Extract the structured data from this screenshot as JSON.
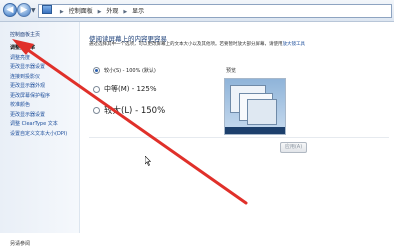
{
  "address_bar": {
    "icon": "control-panel-icon",
    "crumbs": [
      "控制面板",
      "外观",
      "显示"
    ]
  },
  "sidebar": {
    "home_label": "控制面板主页",
    "items": [
      {
        "label": "调整分辨率"
      },
      {
        "label": "调整亮度"
      },
      {
        "label": "更改显示器设置"
      },
      {
        "label": "连接到投影仪"
      },
      {
        "label": "更改显示器外观"
      },
      {
        "label": "更改屏幕保护程序"
      },
      {
        "label": "校准颜色"
      },
      {
        "label": "更改显示器设置"
      },
      {
        "label": "调整 ClearType 文本"
      },
      {
        "label": "设置自定义文本大小(DPI)"
      }
    ],
    "see_also": "另请参阅"
  },
  "main": {
    "title": "使阅读屏幕上的内容更容易",
    "description": "通过选择其中一个选项，可以更改屏幕上的文本大小以及其他项。若要暂时放大部分屏幕，请使用",
    "description_link": "放大镜工具",
    "options": [
      {
        "label": "较小(S) - 100% (默认)",
        "selected": true
      },
      {
        "label": "中等(M) - 125%",
        "selected": false
      },
      {
        "label": "较大(L) - 150%",
        "selected": false
      }
    ],
    "preview_label": "预览",
    "apply_label": "应用(A)"
  },
  "colors": {
    "annotation_arrow": "#e0302a",
    "link": "#1e4f9c",
    "title": "#1a3e78"
  }
}
